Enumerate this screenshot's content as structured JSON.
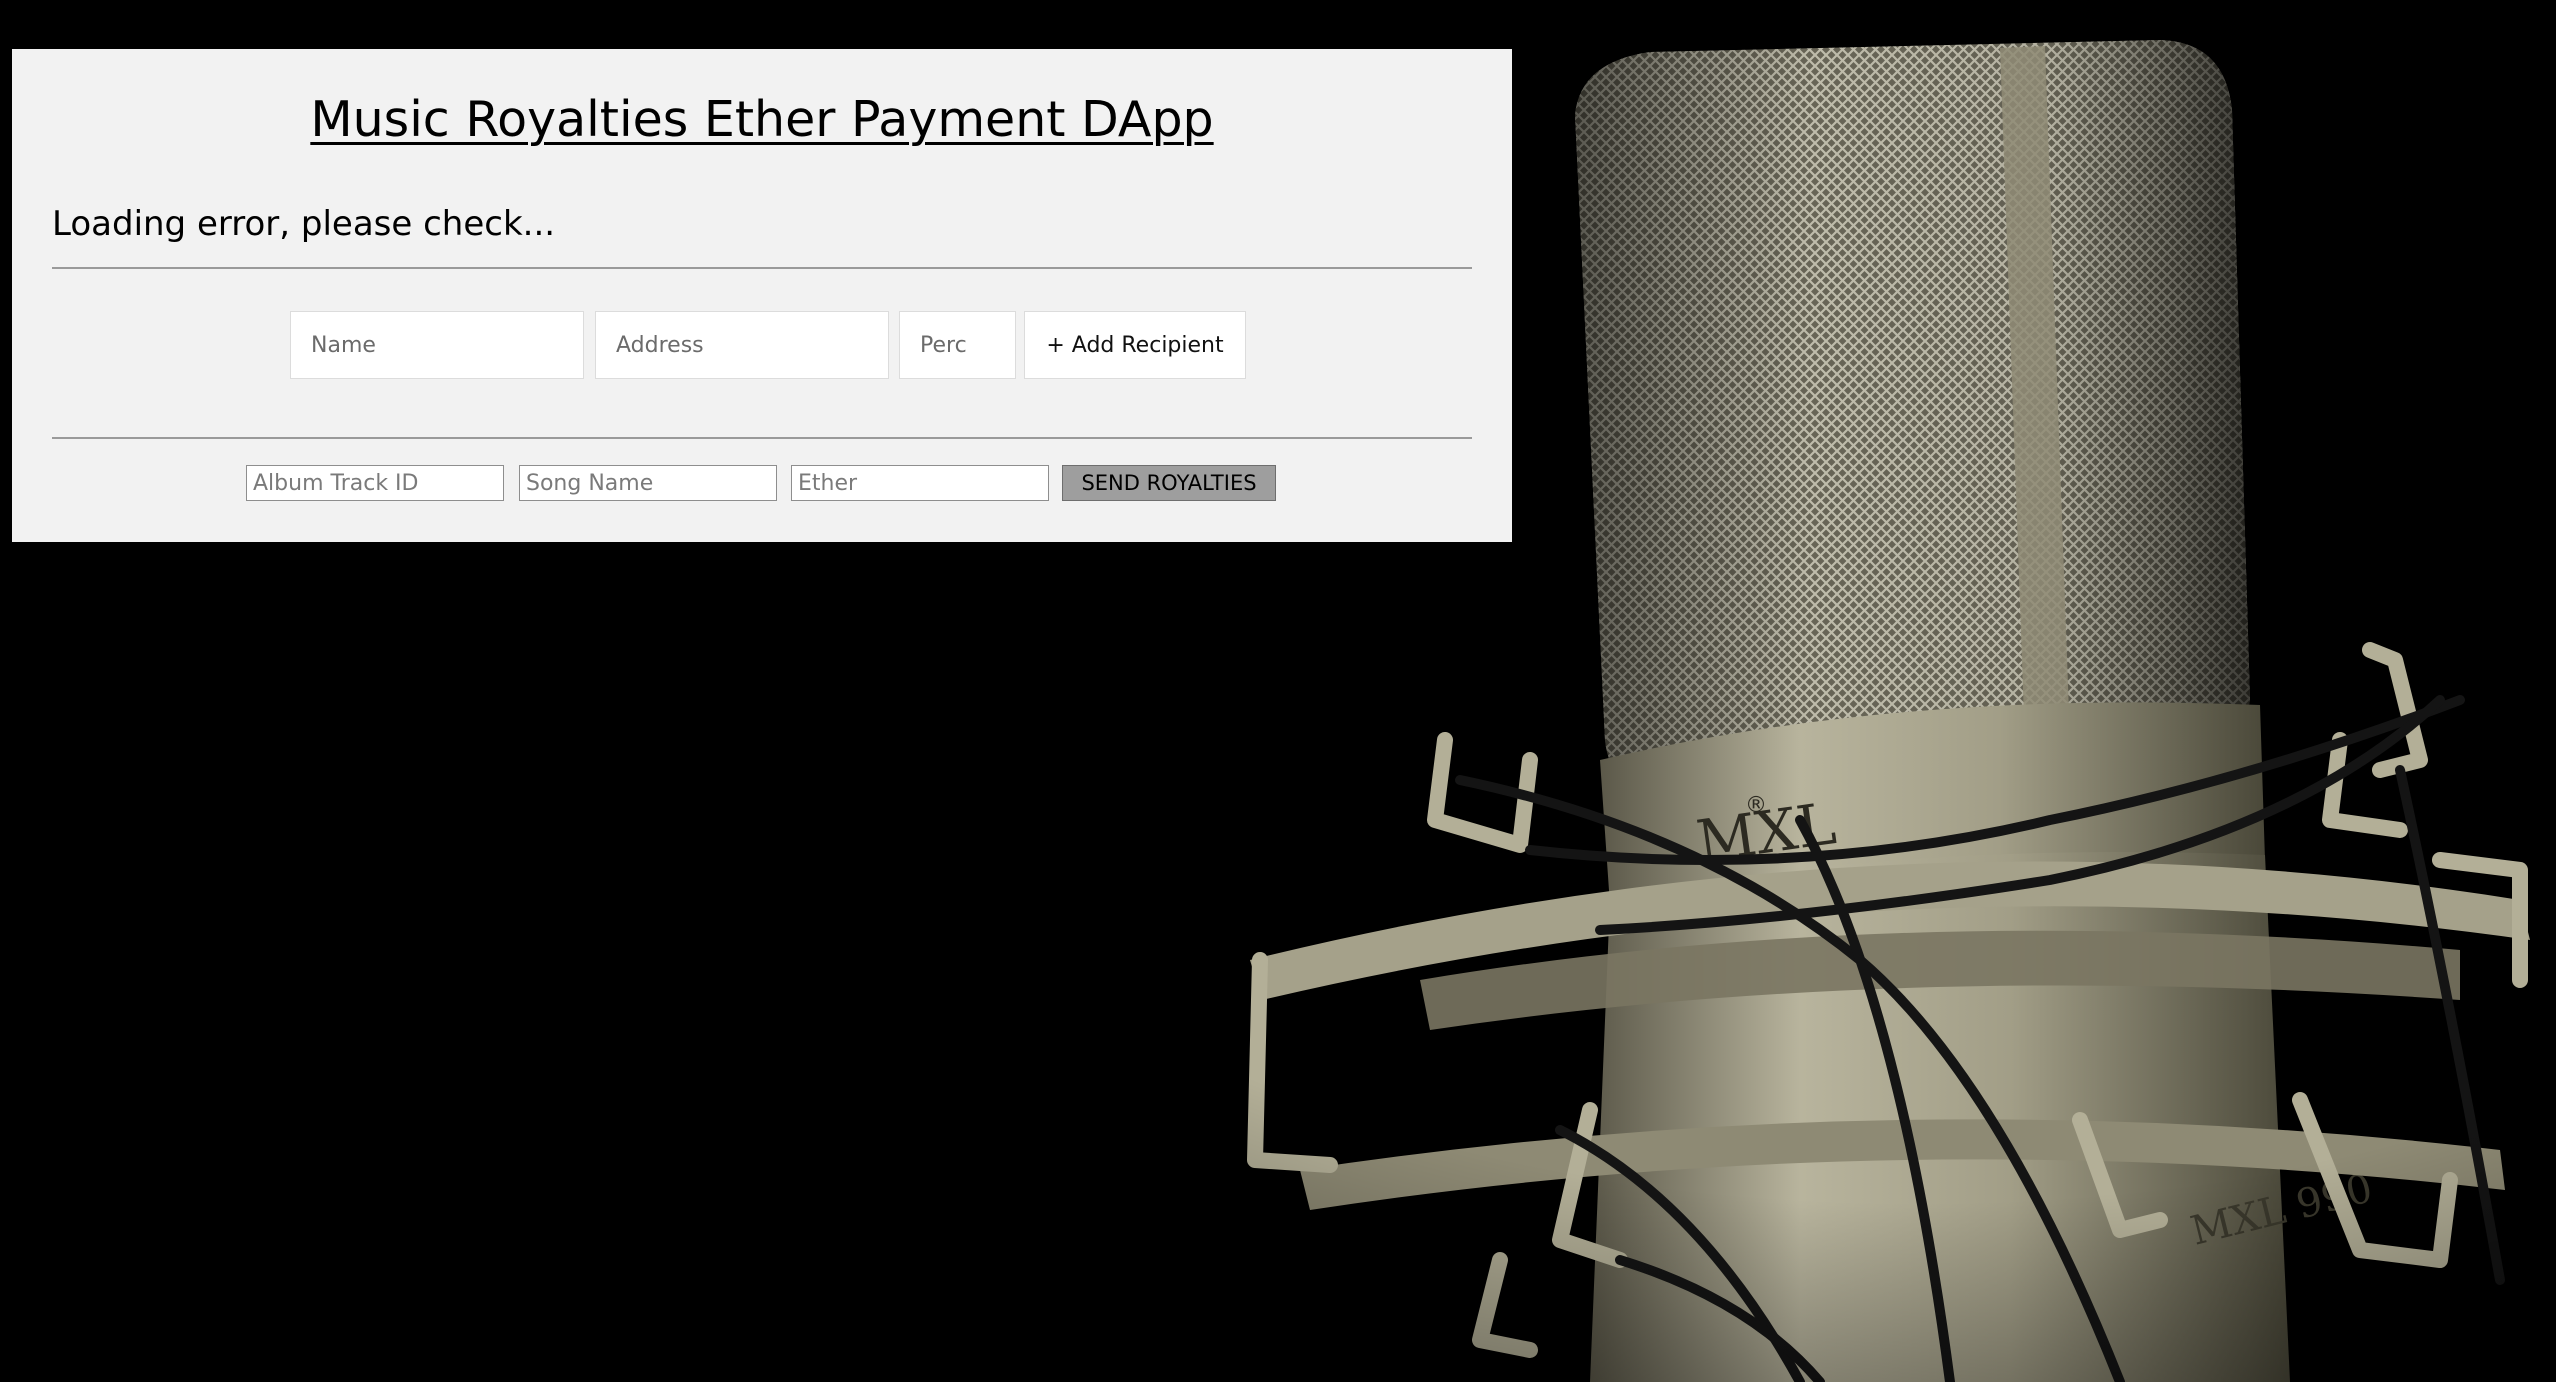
{
  "app": {
    "title": "Music Royalties Ether Payment DApp",
    "status": "Loading error, please check..."
  },
  "recipient_form": {
    "name_placeholder": "Name",
    "address_placeholder": "Address",
    "perc_placeholder": "Perc",
    "add_label": "+ Add Recipient"
  },
  "royalty_form": {
    "album_track_id_placeholder": "Album Track ID",
    "song_name_placeholder": "Song Name",
    "ether_placeholder": "Ether",
    "send_label": "SEND ROYALTIES"
  },
  "background": {
    "brand": "MXL",
    "model": "MXL 990",
    "colors": {
      "page": "#000000",
      "panel": "#f2f2f2",
      "metal": "#a8a48c"
    }
  }
}
